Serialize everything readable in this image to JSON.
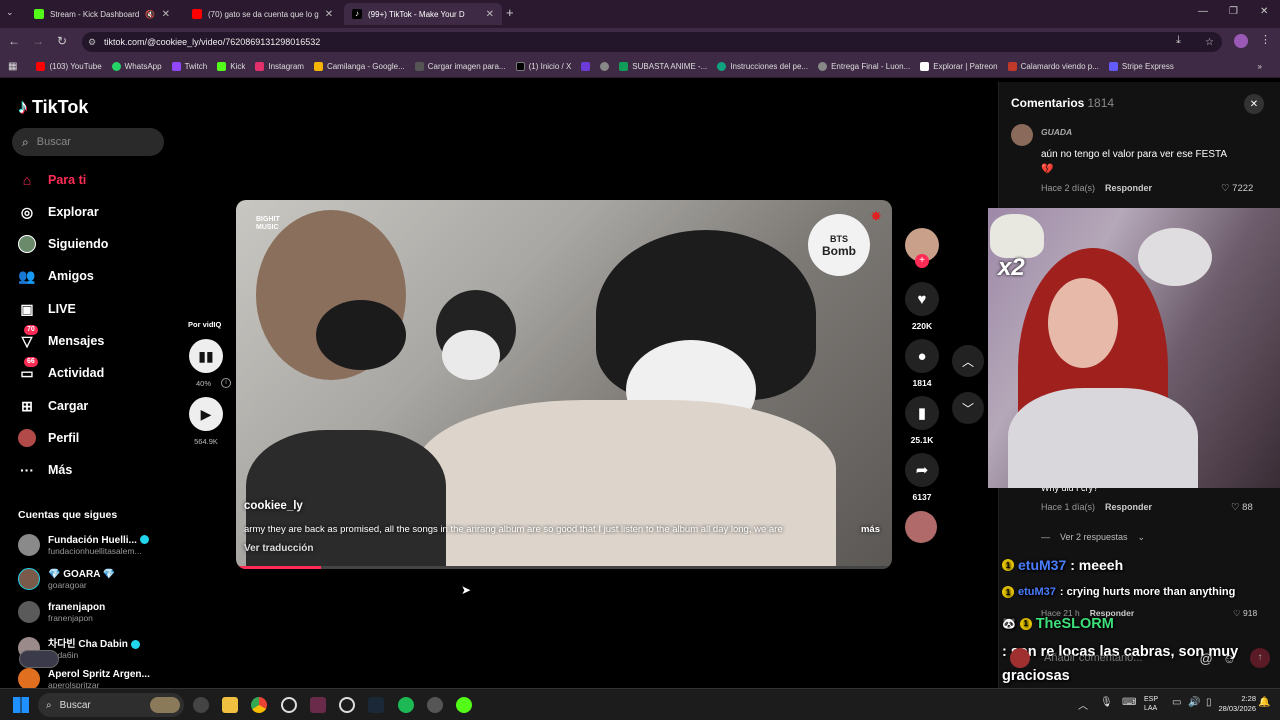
{
  "browser": {
    "tabs": [
      {
        "label": "Stream - Kick Dashboard",
        "color": "#53fc18"
      },
      {
        "label": "(70) gato se da cuenta que lo g",
        "color": "#ff0000"
      },
      {
        "label": "(99+) TikTok - Make Your D",
        "color": "#ffffff",
        "active": true
      }
    ],
    "url": "tiktok.com/@cookiee_ly/video/7620869131298016532",
    "bookmarks": [
      "(103) YouTube",
      "WhatsApp",
      "Twitch",
      "Kick",
      "Instagram",
      "Camilanga - Google...",
      "Cargar imagen para...",
      "(1) Inicio / X",
      "",
      "",
      "SUBASTA ANIME -...",
      "Instrucciones del pe...",
      "Entrega Final - Luon...",
      "Explorar | Patreon",
      "Calamardo viendo p...",
      "Stripe Express"
    ]
  },
  "sidebar": {
    "logo": "TikTok",
    "search_placeholder": "Buscar",
    "nav": [
      {
        "label": "Para ti",
        "icon": "home-icon",
        "active": true
      },
      {
        "label": "Explorar",
        "icon": "compass-icon"
      },
      {
        "label": "Siguiendo",
        "icon": "following-avatar-icon"
      },
      {
        "label": "Amigos",
        "icon": "friends-icon"
      },
      {
        "label": "LIVE",
        "icon": "live-icon"
      },
      {
        "label": "Mensajes",
        "icon": "messages-icon",
        "badge": "70"
      },
      {
        "label": "Actividad",
        "icon": "activity-icon",
        "badge": "66"
      },
      {
        "label": "Cargar",
        "icon": "upload-icon"
      },
      {
        "label": "Perfil",
        "icon": "profile-icon"
      },
      {
        "label": "Más",
        "icon": "more-icon"
      }
    ],
    "following_title": "Cuentas que sigues",
    "accounts": [
      {
        "name": "Fundación Huelli...",
        "user": "fundacionhuellitasalem..."
      },
      {
        "name": "💎 GOARA 💎",
        "user": "goaragoar"
      },
      {
        "name": "franenjapon",
        "user": "franenjapon"
      },
      {
        "name": "차다빈 Cha Dabin",
        "user": "dada6in"
      },
      {
        "name": "Aperol Spritz Argen...",
        "user": "aperolspritzar"
      }
    ]
  },
  "vidiq": {
    "label": "Por vidIQ",
    "percent": "40%",
    "views": "564.9K"
  },
  "video": {
    "channel_label": "BIGHIT MUSIC",
    "watermark_top": "BTS",
    "watermark_bottom": "Bomb",
    "author": "cookiee_ly",
    "description": "army they are back as promised, all the songs in the arirang album are so good that I just listen to the album all day long, we are",
    "more": "más",
    "translate": "Ver traducción",
    "progress": 0.13
  },
  "actions": {
    "likes": "220K",
    "comments": "1814",
    "saves": "25.1K",
    "shares": "6137"
  },
  "comments": {
    "title": "Comentarios",
    "count": "1814",
    "items": [
      {
        "user": "GUADA",
        "text": "aún no tengo el valor para ver ese FESTA",
        "emoji": "💔",
        "time": "Hace 2 día(s)",
        "reply": "Responder",
        "likes": "7222"
      },
      {
        "user": "",
        "text": "Why did I cry?",
        "time": "Hace 1 día(s)",
        "reply": "Responder",
        "likes": "88"
      }
    ],
    "view_replies": "Ver 2 respuestas",
    "third_meta": {
      "time": "Hace 21 h",
      "reply": "Responder",
      "likes": "918"
    },
    "add_placeholder": "Añadir comentario..."
  },
  "stream_overlay": {
    "multiplier": "x2",
    "chat": [
      {
        "user": "etuM37",
        "msg": ": meeeh",
        "user_color": "#4a7cff"
      },
      {
        "user": "etuM37",
        "msg": ": crying hurts more than anything",
        "user_color": "#4a7cff"
      },
      {
        "user": "TheSLORM",
        "msg": ": son re locas las cabras, son muy graciosas",
        "user_color": "#3ee07a"
      }
    ]
  },
  "taskbar": {
    "search": "Buscar",
    "lang_top": "ESP",
    "lang_bottom": "LAA",
    "time": "2:28",
    "date": "28/03/2026"
  },
  "colors": {
    "accent": "#fe2c55",
    "verified": "#20d5ec"
  }
}
